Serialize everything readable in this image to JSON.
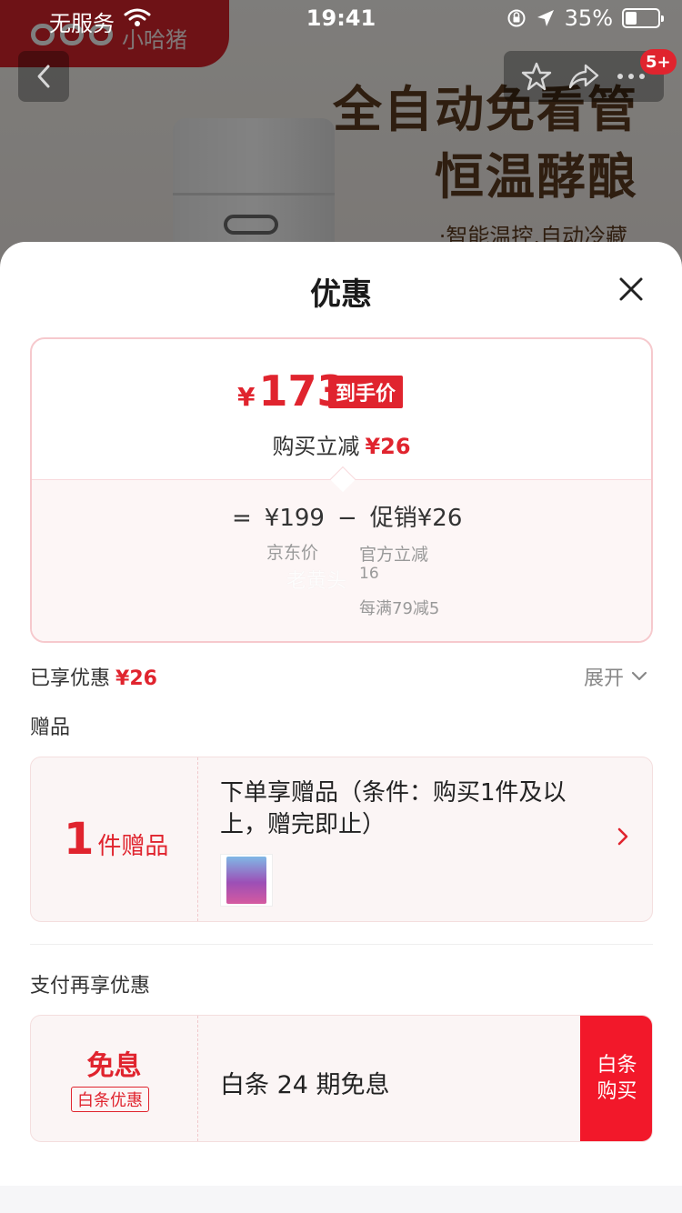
{
  "status_bar": {
    "carrier": "无服务",
    "time": "19:41",
    "battery_percent": "35%"
  },
  "background_page": {
    "brand_name": "小哈猪",
    "headline_line1": "全自动免看管",
    "headline_line2": "恒温酵酿",
    "subline": "·智能温控.自动冷藏",
    "cart_badge": "5+"
  },
  "sheet": {
    "title": "优惠",
    "price_summary": {
      "currency": "¥",
      "final_price": "173",
      "final_price_tag": "到手价",
      "instant_discount_label": "购买立减",
      "instant_discount_value": "¥26",
      "equals": "=",
      "jd_price": "¥199",
      "minus": "−",
      "promo_value": "促销¥26",
      "jd_price_label": "京东价",
      "official_discount_label": "官方立减",
      "official_discount_value": "16",
      "threshold_discount": "每满79减5",
      "watermark": "老黄头"
    },
    "enjoyed": {
      "label": "已享优惠",
      "value": "¥26",
      "expand_label": "展开"
    },
    "gifts": {
      "section_label": "赠品",
      "count_number": "1",
      "count_unit": "件赠品",
      "description": "下单享赠品（条件：购买1件及以上，赠完即止）"
    },
    "payment": {
      "section_label": "支付再享优惠",
      "main_label": "免息",
      "tag_label": "白条优惠",
      "description": "白条 24 期免息",
      "buy_button": "白条购买"
    }
  },
  "colors": {
    "accent_red": "#e0242e",
    "buy_button_red": "#f2182a",
    "card_border_pink": "#f6c9cd"
  },
  "icons": [
    "back-icon",
    "favorite-star-icon",
    "share-icon",
    "more-icon",
    "close-icon",
    "chevron-down-icon",
    "chevron-right-icon",
    "wifi-icon",
    "location-arrow-icon",
    "orientation-lock-icon",
    "battery-icon"
  ]
}
